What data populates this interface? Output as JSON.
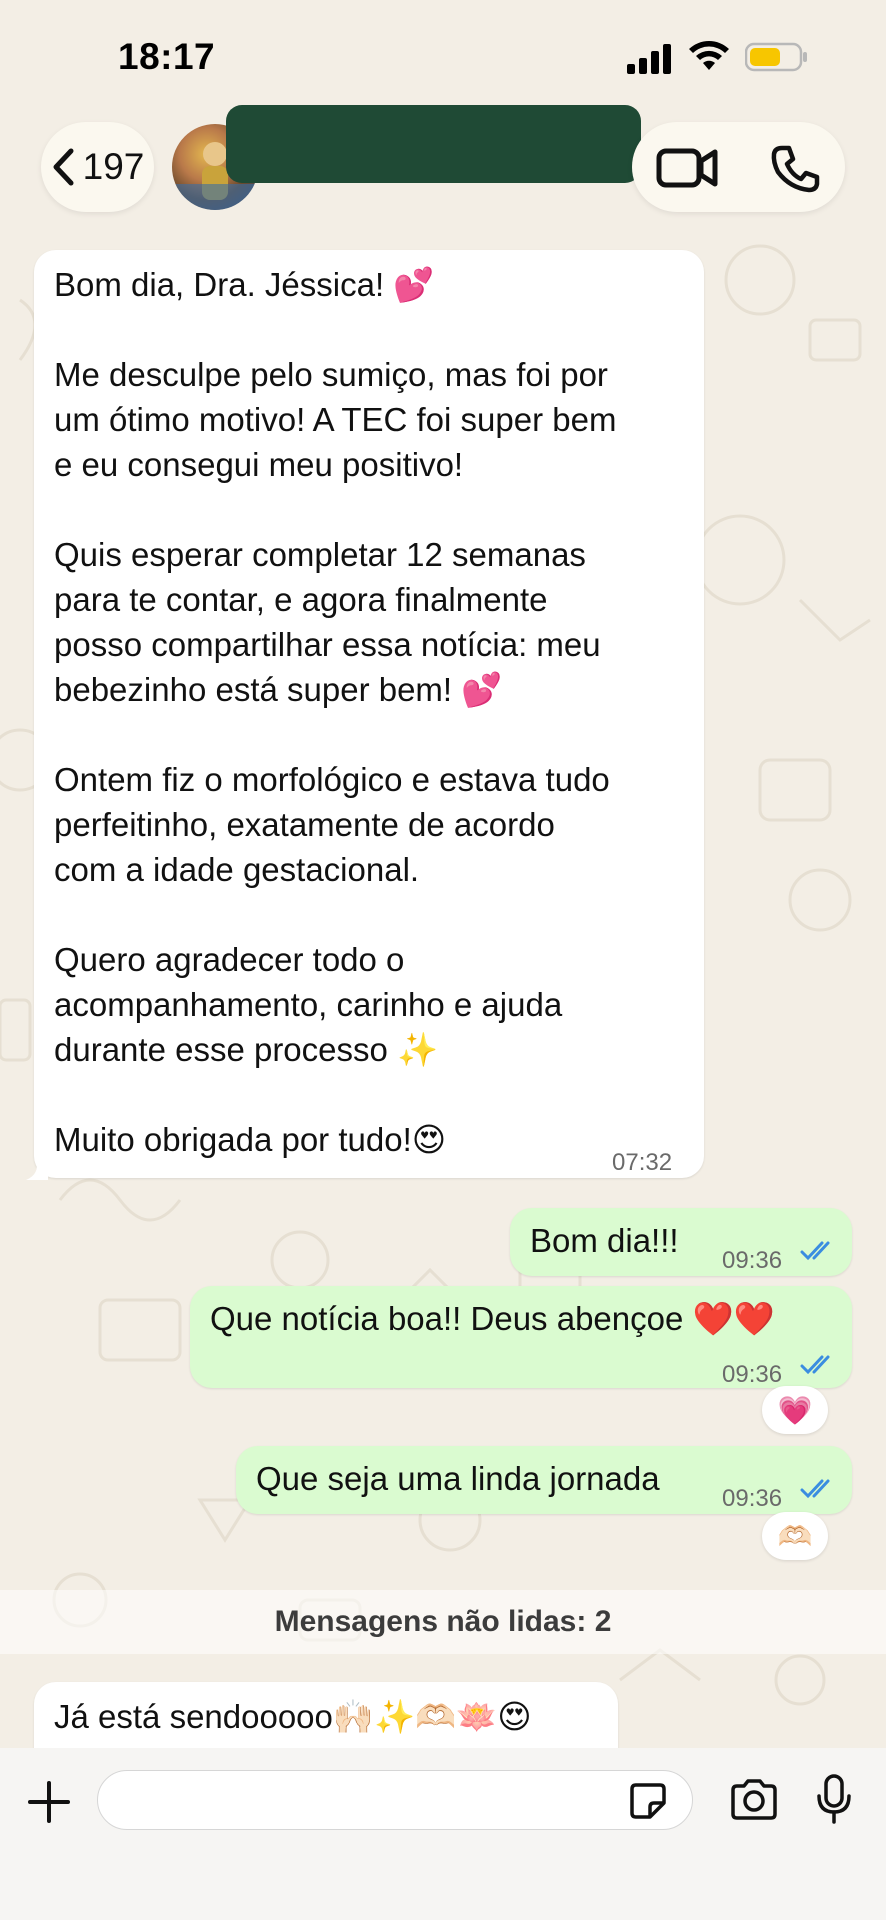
{
  "status_bar": {
    "time": "18:17",
    "battery_color": "#f7c600"
  },
  "header": {
    "back_count": "197",
    "back_icon": "chevron-left-icon",
    "video_icon": "video-camera-icon",
    "call_icon": "phone-icon"
  },
  "messages": {
    "incoming_1": {
      "paragraphs": [
        "Bom dia, Dra. Jéssica! 💕",
        "Me desculpe pelo sumiço, mas foi por\num ótimo motivo! A TEC foi super bem\ne eu consegui meu positivo!",
        "Quis esperar completar 12 semanas\npara te contar, e agora finalmente\nposso compartilhar essa notícia: meu\nbebezinho está super bem! 💕",
        "Ontem fiz o morfológico e estava tudo\nperfeitinho, exatamente de acordo\ncom a idade gestacional.",
        "Quero agradecer todo o\nacompanhamento, carinho e ajuda\ndurante esse processo ✨",
        "Muito obrigada por tudo!😍"
      ],
      "time": "07:32"
    },
    "outgoing_1": {
      "text": "Bom dia!!!",
      "time": "09:36"
    },
    "outgoing_2": {
      "text": "Que notícia boa!! Deus abençoe ❤️❤️",
      "time": "09:36",
      "reaction": "💗"
    },
    "outgoing_3": {
      "text": "Que seja uma linda jornada",
      "time": "09:36",
      "reaction": "🫶🏻"
    },
    "unread_banner": "Mensagens não lidas: 2",
    "incoming_2": {
      "text": "Já está sendooooo🙌🏻✨🫶🏻🪷😍"
    }
  },
  "composer": {
    "placeholder": "",
    "plus_icon": "plus-icon",
    "sticker_icon": "sticker-icon",
    "camera_icon": "camera-icon",
    "mic_icon": "microphone-icon"
  },
  "colors": {
    "outgoing_bubble": "#dafbd0",
    "incoming_bubble": "#ffffff",
    "read_ticks": "#3a8de0",
    "wallpaper": "#f3eee5"
  }
}
